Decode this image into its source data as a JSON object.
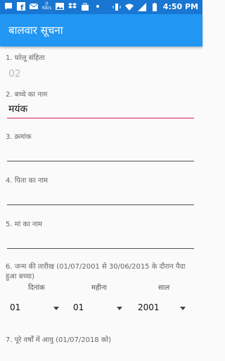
{
  "status_bar": {
    "time": "4:50 PM",
    "kbs": "0\nKB/s",
    "left_icons": [
      "sms-icon",
      "facebook-icon",
      "mail-icon",
      "speed-icon",
      "image-icon",
      "dropbox-icon",
      "bag-icon",
      "dot-icon"
    ],
    "right_icons": [
      "vibrate-icon",
      "wifi-icon",
      "signal-icon",
      "battery-icon"
    ]
  },
  "appbar": {
    "title": "बालवार सूचना"
  },
  "form": {
    "q1": {
      "label": "1. घरेलू संहिता",
      "value": "02"
    },
    "q2": {
      "label": "2. बच्चे का नाम",
      "value": "मयंक"
    },
    "q3": {
      "label": "3. क्रमांक",
      "value": ""
    },
    "q4": {
      "label": "4. पिता का नाम",
      "value": ""
    },
    "q5": {
      "label": "5. मां का नाम",
      "value": ""
    },
    "q6": {
      "label_line1": "6. जन्म की तारीख (01/07/2001 से 30/06/2015 के दौरान पैदा",
      "label_line2": "हुआ बच्चा)",
      "day_header": "दिनांक",
      "month_header": "महीना",
      "year_header": "साल",
      "day_value": "01",
      "month_value": "01",
      "year_value": "2001"
    },
    "q7": {
      "label": "7. पूरे वर्षों में आयु (01/07/2018 को)"
    }
  },
  "colors": {
    "status_bar": "#1976d2",
    "app_bar": "#2196f3",
    "accent": "#d81b60"
  }
}
